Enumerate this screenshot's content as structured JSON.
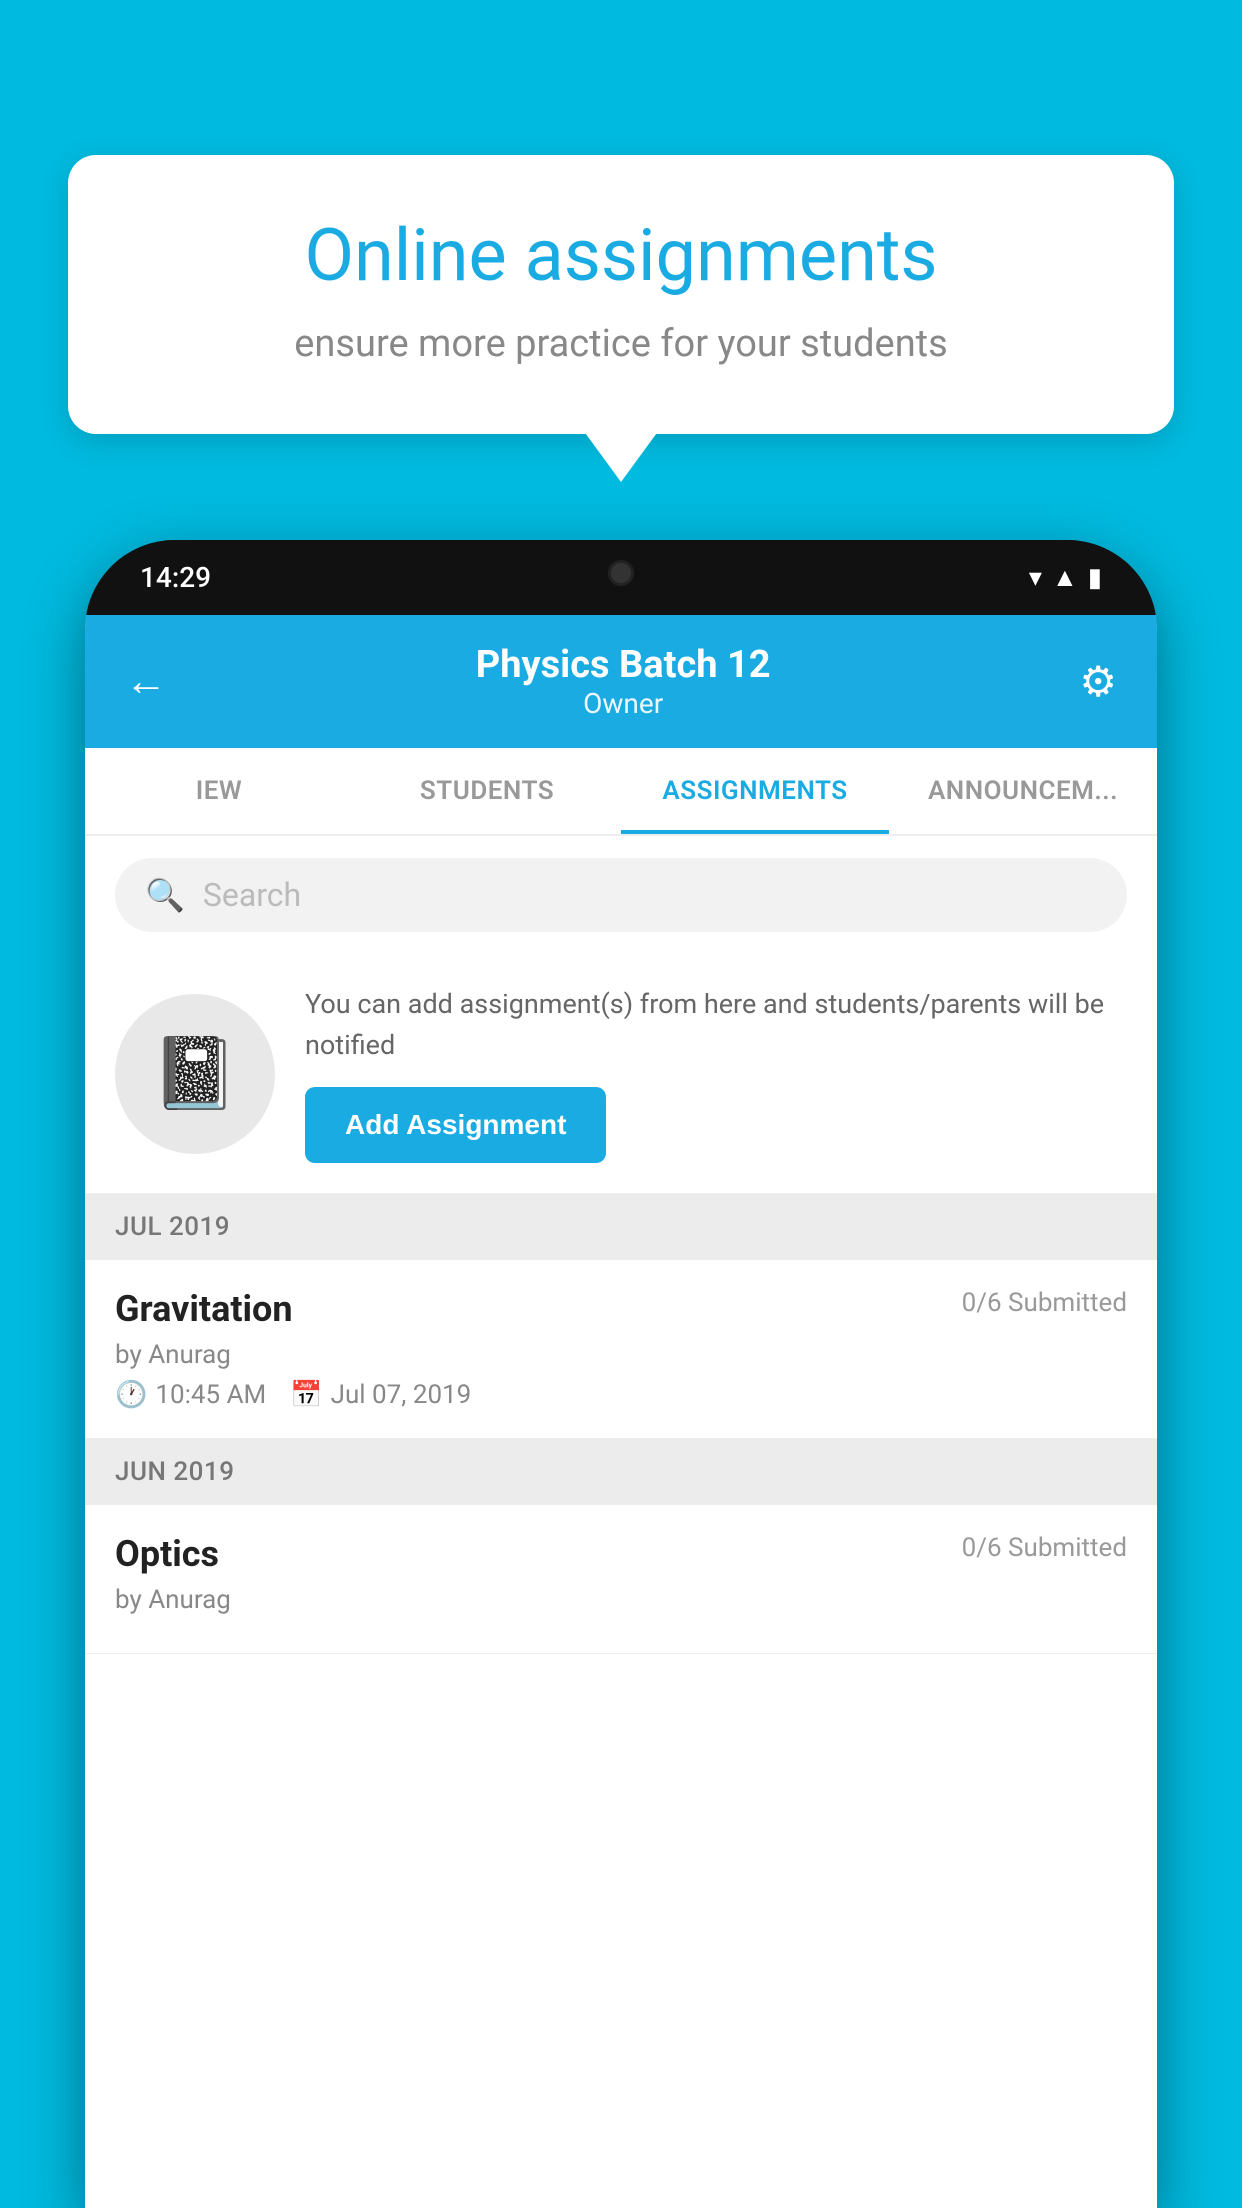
{
  "background_color": "#00BADF",
  "speech_bubble": {
    "title": "Online assignments",
    "subtitle": "ensure more practice for your students"
  },
  "status_bar": {
    "time": "14:29",
    "icons": [
      "wifi",
      "signal",
      "battery"
    ]
  },
  "header": {
    "title": "Physics Batch 12",
    "subtitle": "Owner",
    "back_label": "←",
    "settings_label": "⚙"
  },
  "tabs": [
    {
      "label": "IEW",
      "active": false
    },
    {
      "label": "STUDENTS",
      "active": false
    },
    {
      "label": "ASSIGNMENTS",
      "active": true
    },
    {
      "label": "ANNOUNCEM...",
      "active": false
    }
  ],
  "search": {
    "placeholder": "Search"
  },
  "promo": {
    "text": "You can add assignment(s) from here and students/parents will be notified",
    "button_label": "Add Assignment"
  },
  "sections": [
    {
      "label": "JUL 2019",
      "assignments": [
        {
          "name": "Gravitation",
          "submitted": "0/6 Submitted",
          "by": "by Anurag",
          "time": "10:45 AM",
          "date": "Jul 07, 2019"
        }
      ]
    },
    {
      "label": "JUN 2019",
      "assignments": [
        {
          "name": "Optics",
          "submitted": "0/6 Submitted",
          "by": "by Anurag",
          "time": "",
          "date": ""
        }
      ]
    }
  ]
}
